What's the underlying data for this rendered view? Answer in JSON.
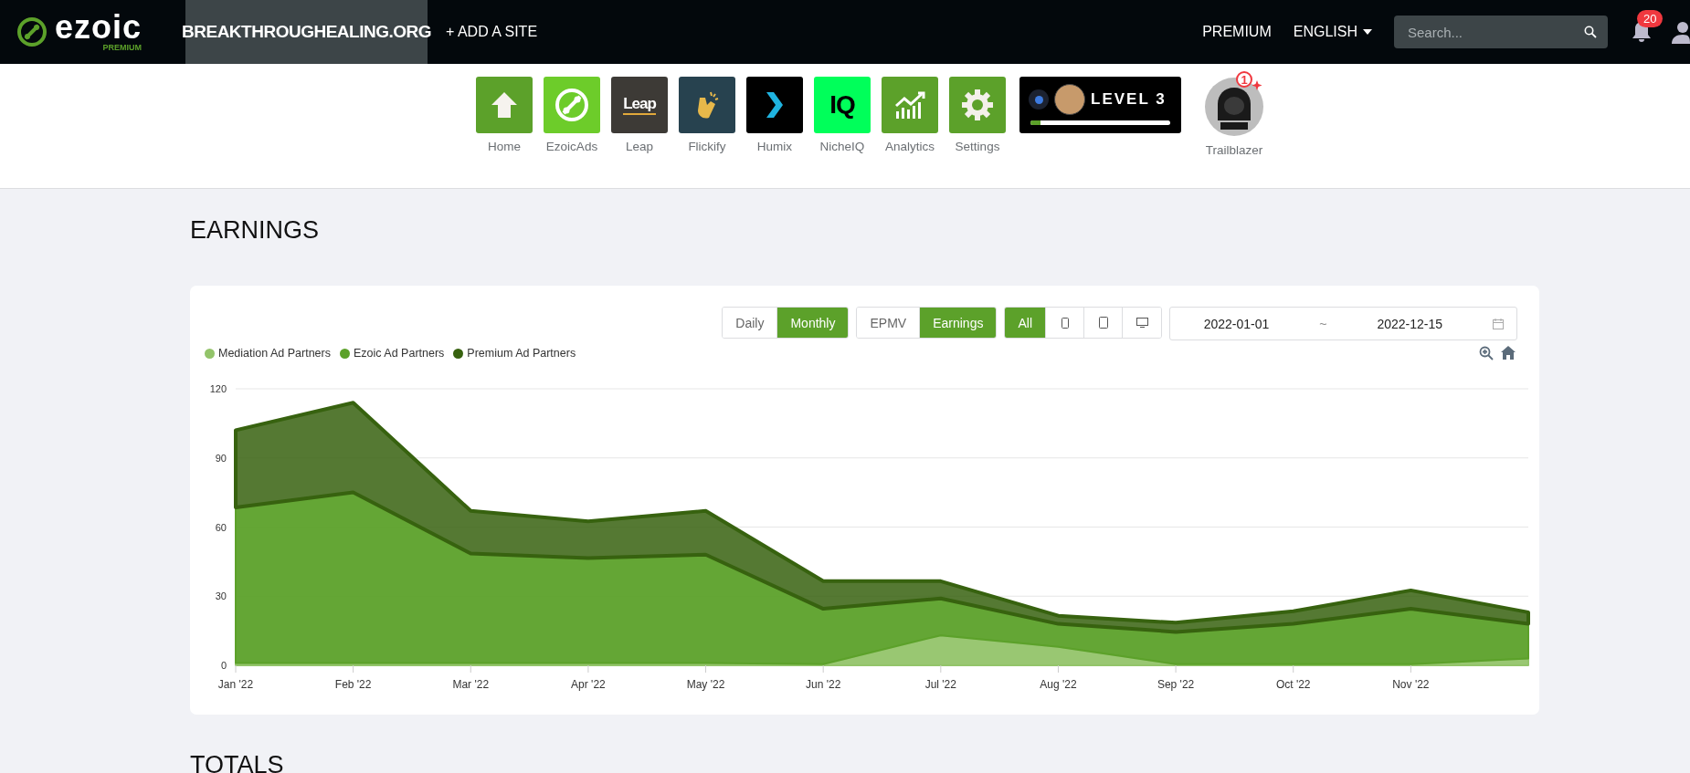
{
  "topbar": {
    "logo": "ezoic",
    "logo_badge": "PREMIUM",
    "site": "BREAKTHROUGHEALING.ORG",
    "add_site": "+ ADD A SITE",
    "links": [
      "PREMIUM",
      "ENGLISH"
    ],
    "search": {
      "placeholder": "Search..."
    },
    "notifications": "20"
  },
  "apps": [
    {
      "kind": "home",
      "label": "Home"
    },
    {
      "kind": "ezoicads",
      "label": "EzoicAds"
    },
    {
      "kind": "leap",
      "label": "Leap",
      "logo_text": "Leap"
    },
    {
      "kind": "flickify",
      "label": "Flickify"
    },
    {
      "kind": "humix",
      "label": "Humix"
    },
    {
      "kind": "nicheiq",
      "label": "NicheIQ",
      "logo_text": "IQ"
    },
    {
      "kind": "analytics",
      "label": "Analytics"
    },
    {
      "kind": "settings",
      "label": "Settings"
    }
  ],
  "level_card": {
    "label": "LEVEL 3",
    "level": 0.07
  },
  "trailblazer": {
    "label": "Trailblazer",
    "badge": "1"
  },
  "earnings": {
    "title": "EARNINGS",
    "granularity": [
      {
        "label": "Daily",
        "selected": false
      },
      {
        "label": "Monthly",
        "selected": true
      }
    ],
    "metric": [
      {
        "label": "EPMV",
        "selected": false
      },
      {
        "label": "Earnings",
        "selected": true
      }
    ],
    "devices": [
      {
        "kind": "all",
        "label": "All",
        "selected": true
      },
      {
        "kind": "phone",
        "selected": false
      },
      {
        "kind": "tablet",
        "selected": false
      },
      {
        "kind": "desktop",
        "selected": false
      }
    ],
    "date_from": "2022-01-01",
    "date_separator": "~",
    "date_to": "2022-12-15",
    "chart_data": {
      "type": "area",
      "stacked": true,
      "categories": [
        "Jan '22",
        "Feb '22",
        "Mar '22",
        "Apr '22",
        "May '22",
        "Jun '22",
        "Jul '22",
        "Aug '22",
        "Sep '22",
        "Oct '22",
        "Nov '22",
        null
      ],
      "ylim": [
        0,
        120
      ],
      "grid": true,
      "yticks": [
        0,
        30,
        60,
        90,
        120
      ],
      "series": [
        {
          "name": "Mediation Ad Partners",
          "color": "#93c46a",
          "values": [
            1,
            1,
            1,
            1,
            1,
            0.5,
            13,
            8,
            0.5,
            0.5,
            0.5,
            3
          ]
        },
        {
          "name": "Ezoic Ad Partners",
          "color": "#5ca12a",
          "values": [
            67.5,
            74,
            47.5,
            45.5,
            47,
            24,
            16,
            10,
            14,
            17.5,
            24,
            15
          ]
        },
        {
          "name": "Premium Ad Partners",
          "color": "#37620f",
          "values": [
            33.5,
            39,
            18.5,
            16,
            19,
            12,
            7.5,
            3.5,
            4,
            5.5,
            8,
            5
          ]
        }
      ]
    }
  },
  "totals": {
    "title": "TOTALS"
  }
}
